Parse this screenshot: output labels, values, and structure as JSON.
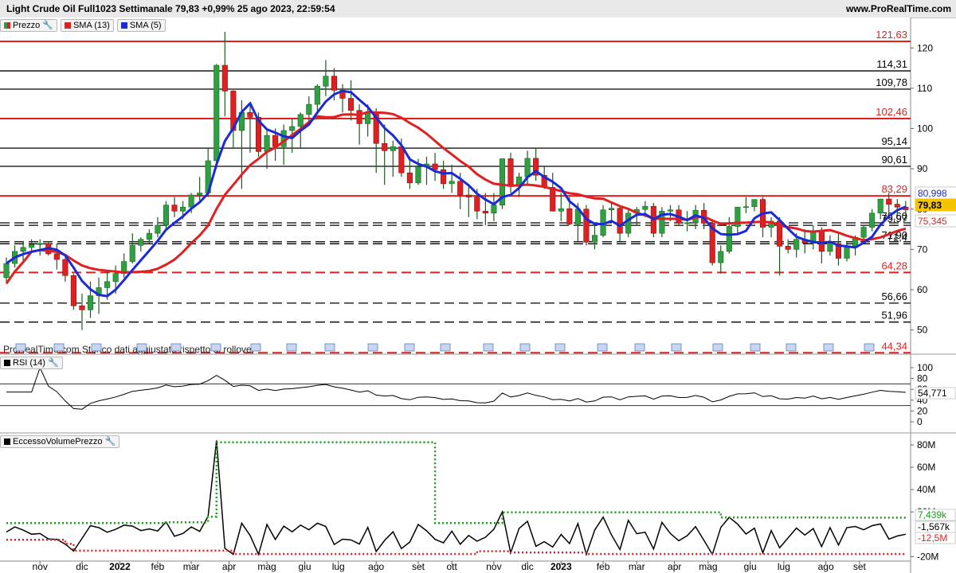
{
  "header": {
    "title": "Light Crude Oil Full1023 Settimanale 79,83 +0,99% 25 ago 2023, 22:59:54",
    "site": "www.ProRealTime.com"
  },
  "legend_main": [
    {
      "name": "legend-prezzo",
      "label": "Prezzo",
      "swatch": "split"
    },
    {
      "name": "legend-sma13",
      "label": "SMA (13)",
      "swatch": "#e02020"
    },
    {
      "name": "legend-sma5",
      "label": "SMA (5)",
      "swatch": "#1a2bd6"
    }
  ],
  "legend_rsi": {
    "label": "RSI (14)"
  },
  "legend_vol": {
    "label": "EccessoVolumePrezzo"
  },
  "watermark": "ProRealTime.com Storico dati aggiustato rispetto ai rollover",
  "colors": {
    "up": "#2ea043",
    "down": "#e02020",
    "sma13": "#e02020",
    "sma5": "#1a2bd6",
    "rsi": "#000000",
    "band_top": "#1b9a1b",
    "band_bottom": "#e02020"
  },
  "chart_data": [
    {
      "type": "candlestick",
      "title": "Light Crude Oil Full1023 Settimanale",
      "ylim": [
        44,
        124
      ],
      "yticks": [
        50,
        60,
        70,
        80,
        90,
        100,
        110,
        120
      ],
      "x_labels": [
        "nov",
        "dic",
        "2022",
        "feb",
        "mar",
        "apr",
        "mag",
        "giu",
        "lug",
        "ago",
        "set",
        "ott",
        "nov",
        "dic",
        "2023",
        "feb",
        "mar",
        "apr",
        "mag",
        "giu",
        "lug",
        "ago",
        "set"
      ],
      "x_label_weeks": [
        4,
        9,
        13.5,
        18,
        22,
        26.5,
        31,
        35.5,
        39.5,
        44,
        49,
        53,
        58,
        62,
        66,
        71,
        75,
        79.5,
        83.5,
        88.5,
        92.5,
        97.5,
        101.5
      ],
      "levels": [
        {
          "value": 121.63,
          "label": "121,63",
          "style": "solid",
          "color": "#e02020"
        },
        {
          "value": 114.31,
          "label": "114,31",
          "style": "solid",
          "color": "#000000"
        },
        {
          "value": 109.78,
          "label": "109,78",
          "style": "solid",
          "color": "#000000"
        },
        {
          "value": 102.46,
          "label": "102,46",
          "style": "solid",
          "color": "#e02020"
        },
        {
          "value": 95.14,
          "label": "95,14",
          "style": "solid",
          "color": "#000000"
        },
        {
          "value": 90.61,
          "label": "90,61",
          "style": "solid",
          "color": "#000000"
        },
        {
          "value": 83.29,
          "label": "83,29",
          "style": "solid",
          "color": "#e02020"
        },
        {
          "value": 76.6,
          "label": "76,60",
          "style": "dashed",
          "color": "#000000"
        },
        {
          "value": 75.97,
          "label": "75,97",
          "style": "dashed",
          "color": "#000000"
        },
        {
          "value": 71.9,
          "label": "71,90",
          "style": "dashed",
          "color": "#000000"
        },
        {
          "value": 71.4,
          "label": "71,4",
          "style": "dashed",
          "color": "#000000"
        },
        {
          "value": 64.28,
          "label": "64,28",
          "style": "dashed",
          "color": "#e02020"
        },
        {
          "value": 56.66,
          "label": "56,66",
          "style": "dashed",
          "color": "#000000"
        },
        {
          "value": 51.96,
          "label": "51,96",
          "style": "dashed",
          "color": "#000000"
        },
        {
          "value": 44.34,
          "label": "44,34",
          "style": "dashed",
          "color": "#e02020"
        }
      ],
      "badges": [
        {
          "label": "80,998",
          "value": 81.0,
          "bg": "#ffffff",
          "fg": "#1a2bd6"
        },
        {
          "label": "79,83",
          "value": 79.83,
          "bg": "#f5c400",
          "fg": "#000000"
        },
        {
          "label": "75,345",
          "value": 75.35,
          "bg": "#ffffff",
          "fg": "#e02020"
        }
      ],
      "candles": [
        [
          63.0,
          68.0,
          62.0,
          66.5
        ],
        [
          66.5,
          71.0,
          65.5,
          69.5
        ],
        [
          69.5,
          72.0,
          67.0,
          70.5
        ],
        [
          70.5,
          72.5,
          69.5,
          71.2
        ],
        [
          71.2,
          72.5,
          68.5,
          71.5
        ],
        [
          71.5,
          72.0,
          68.5,
          68.9
        ],
        [
          68.9,
          71.5,
          65.0,
          67.5
        ],
        [
          67.5,
          68.0,
          62.0,
          63.5
        ],
        [
          63.5,
          64.0,
          55.0,
          56.0
        ],
        [
          56.0,
          59.0,
          50.0,
          55.0
        ],
        [
          55.0,
          62.0,
          53.0,
          58.5
        ],
        [
          58.5,
          63.0,
          54.0,
          60.5
        ],
        [
          60.5,
          64.5,
          57.5,
          62.0
        ],
        [
          62.0,
          66.0,
          59.0,
          64.0
        ],
        [
          64.0,
          69.0,
          63.0,
          67.0
        ],
        [
          67.0,
          74.0,
          66.5,
          71.0
        ],
        [
          71.0,
          73.0,
          69.5,
          72.5
        ],
        [
          72.5,
          75.0,
          71.5,
          74.0
        ],
        [
          74.0,
          78.0,
          73.0,
          76.0
        ],
        [
          76.0,
          82.0,
          75.0,
          81.0
        ],
        [
          81.0,
          83.0,
          78.0,
          79.5
        ],
        [
          79.5,
          82.0,
          77.5,
          80.5
        ],
        [
          80.5,
          84.0,
          79.0,
          83.5
        ],
        [
          83.5,
          88.0,
          82.0,
          84.0
        ],
        [
          84.0,
          95.0,
          83.0,
          92.0
        ],
        [
          92.0,
          116.0,
          90.0,
          115.7
        ],
        [
          115.7,
          124.0,
          103.0,
          109.3
        ],
        [
          109.3,
          109.5,
          95.0,
          99.5
        ],
        [
          99.5,
          107.0,
          85.0,
          104.0
        ],
        [
          104.0,
          106.0,
          94.0,
          102.8
        ],
        [
          102.8,
          104.0,
          93.0,
          94.3
        ],
        [
          94.3,
          99.5,
          90.0,
          98.3
        ],
        [
          98.3,
          100.0,
          92.0,
          95.5
        ],
        [
          95.5,
          101.0,
          91.0,
          99.5
        ],
        [
          99.5,
          102.5,
          94.0,
          100.5
        ],
        [
          100.5,
          104.0,
          95.0,
          103.5
        ],
        [
          103.5,
          108.0,
          101.0,
          106.0
        ],
        [
          106.0,
          111.0,
          104.0,
          110.5
        ],
        [
          110.5,
          117.0,
          108.0,
          113.0
        ],
        [
          113.0,
          115.0,
          107.0,
          109.5
        ],
        [
          109.5,
          111.0,
          104.0,
          107.5
        ],
        [
          107.5,
          112.0,
          102.0,
          104.5
        ],
        [
          104.5,
          106.0,
          96.0,
          101.2
        ],
        [
          101.2,
          106.0,
          98.0,
          104.0
        ],
        [
          104.0,
          105.0,
          89.0,
          96.3
        ],
        [
          96.3,
          101.0,
          86.0,
          94.5
        ],
        [
          94.5,
          97.0,
          88.0,
          95.5
        ],
        [
          95.5,
          97.5,
          88.0,
          89.0
        ],
        [
          89.0,
          93.0,
          85.0,
          86.5
        ],
        [
          86.5,
          92.5,
          86.0,
          90.5
        ],
        [
          90.5,
          93.0,
          86.0,
          91.2
        ],
        [
          91.2,
          94.0,
          87.0,
          89.8
        ],
        [
          89.8,
          92.0,
          85.0,
          86.3
        ],
        [
          86.3,
          91.0,
          84.0,
          86.9
        ],
        [
          86.9,
          89.0,
          80.0,
          83.5
        ],
        [
          83.5,
          86.0,
          78.0,
          83.0
        ],
        [
          83.0,
          85.0,
          77.5,
          79.5
        ],
        [
          79.5,
          84.0,
          76.0,
          79.0
        ],
        [
          79.0,
          84.0,
          77.0,
          81.0
        ],
        [
          81.0,
          92.0,
          80.0,
          92.5
        ],
        [
          92.5,
          94.0,
          84.0,
          85.6
        ],
        [
          85.6,
          89.0,
          83.0,
          88.0
        ],
        [
          88.0,
          94.5,
          86.0,
          92.6
        ],
        [
          92.6,
          95.0,
          87.0,
          88.4
        ],
        [
          88.4,
          90.5,
          85.0,
          85.4
        ],
        [
          85.4,
          89.0,
          80.0,
          79.5
        ],
        [
          79.5,
          84.0,
          77.0,
          80.1
        ],
        [
          80.1,
          83.0,
          76.0,
          76.3
        ],
        [
          76.3,
          81.5,
          72.0,
          80.0
        ],
        [
          80.0,
          81.0,
          71.0,
          71.8
        ],
        [
          71.8,
          76.0,
          70.0,
          73.5
        ],
        [
          73.5,
          81.0,
          73.0,
          79.8
        ],
        [
          79.8,
          81.5,
          76.5,
          80.2
        ],
        [
          80.2,
          81.0,
          72.0,
          74.0
        ],
        [
          74.0,
          80.0,
          73.0,
          79.0
        ],
        [
          79.0,
          80.5,
          76.0,
          79.9
        ],
        [
          79.9,
          82.0,
          78.0,
          80.7
        ],
        [
          80.7,
          81.5,
          73.0,
          74.0
        ],
        [
          74.0,
          80.5,
          73.0,
          79.5
        ],
        [
          79.5,
          81.0,
          77.0,
          79.8
        ],
        [
          79.8,
          81.0,
          76.0,
          76.5
        ],
        [
          76.5,
          79.5,
          74.5,
          76.6
        ],
        [
          76.6,
          81.0,
          75.0,
          79.7
        ],
        [
          79.7,
          81.5,
          75.0,
          76.5
        ],
        [
          76.5,
          77.5,
          66.0,
          66.7
        ],
        [
          66.7,
          71.0,
          64.0,
          69.5
        ],
        [
          69.5,
          78.0,
          69.0,
          75.7
        ],
        [
          75.7,
          80.0,
          74.0,
          80.5
        ],
        [
          80.5,
          83.0,
          79.0,
          80.6
        ],
        [
          80.6,
          82.0,
          79.5,
          82.4
        ],
        [
          82.4,
          83.0,
          73.0,
          75.5
        ],
        [
          75.5,
          78.0,
          73.0,
          77.0
        ],
        [
          77.0,
          78.0,
          63.5,
          70.8
        ],
        [
          70.8,
          72.5,
          69.0,
          70.0
        ],
        [
          70.0,
          74.0,
          68.0,
          72.5
        ],
        [
          72.5,
          75.0,
          69.0,
          71.5
        ]
      ],
      "candles_tail": [
        [
          71.5,
          76.0,
          70.0,
          74.5
        ],
        [
          74.5,
          75.5,
          66.5,
          69.5
        ],
        [
          69.5,
          73.5,
          68.5,
          71.5
        ],
        [
          71.5,
          74.0,
          66.0,
          67.8
        ],
        [
          67.8,
          72.0,
          67.0,
          70.5
        ],
        [
          70.5,
          73.5,
          68.5,
          73.0
        ],
        [
          73.0,
          76.0,
          72.0,
          75.5
        ],
        [
          75.5,
          80.0,
          74.5,
          79.0
        ],
        [
          79.0,
          81.5,
          77.5,
          82.5
        ],
        [
          82.5,
          84.0,
          79.0,
          81.2
        ],
        [
          81.2,
          82.5,
          78.5,
          80.5
        ],
        [
          80.5,
          82.0,
          77.0,
          79.83
        ]
      ],
      "sma5": [
        58,
        60,
        62,
        63.5,
        65,
        66.5,
        68,
        68.5,
        68.8,
        68.5,
        67.8,
        66,
        64,
        61.5,
        59,
        57,
        56,
        55.5,
        55.5,
        56.5,
        58,
        59.5,
        61,
        62.5,
        64.5,
        67,
        69.5,
        72,
        74,
        76,
        78,
        80,
        82,
        83.5,
        85,
        86.5,
        88.5,
        91,
        95,
        96.5,
        97.5,
        98.5,
        99,
        98.5,
        97.5,
        96.7,
        97,
        98,
        99.5,
        101,
        103,
        105,
        107.5,
        109,
        109.2,
        108.8,
        108,
        107,
        105.5,
        104,
        102,
        99.5,
        98,
        97.5,
        97,
        95,
        93,
        91,
        89.7,
        88.5,
        88,
        87.5,
        87.2,
        87.5,
        87.5,
        87.3,
        86.5,
        86,
        85.5,
        84.5,
        83.5,
        83,
        82.3,
        82.3,
        83,
        84,
        85,
        86.5,
        88.5,
        89.5,
        89,
        87.5,
        85.5,
        84,
        82.7,
        80.8,
        79,
        77.5,
        77,
        76.8,
        77.5,
        78.5,
        79,
        78.3,
        77.8,
        77.5,
        77.7,
        77.8,
        78.3,
        78.5,
        79.5,
        79.7,
        78.7,
        78,
        76.5,
        76.3,
        75,
        74.6,
        72.5,
        72,
        72.3,
        73.1,
        74.4,
        75.8,
        76.6,
        77.0,
        76.5,
        75.6,
        74.5,
        73.5,
        72.8,
        72.2,
        71.9,
        71.5,
        71.5,
        70.8,
        70.2,
        70.0,
        70.5,
        71.3,
        72.5,
        73.6,
        75.0,
        76.9,
        78.3,
        79.5,
        80.4,
        81.0
      ]
    }
  ],
  "rsi": {
    "label": "RSI (14)",
    "ylim": [
      20,
      100
    ],
    "yticks": [
      100,
      80,
      60,
      40,
      20,
      0
    ],
    "ref_levels": [
      70,
      30
    ],
    "current_label": "54,771"
  },
  "eccesso": {
    "label": "EccessoVolumePrezzo",
    "ylim": [
      -24,
      90
    ],
    "yticks": [
      {
        "v": 80,
        "label": "80M"
      },
      {
        "v": 60,
        "label": "60M"
      },
      {
        "v": 40,
        "label": "40M"
      },
      {
        "v": 20,
        "label": "20M"
      },
      {
        "v": -20,
        "label": "-20M"
      }
    ],
    "badges": [
      {
        "label": "7,439k",
        "fg": "#1b9a1b"
      },
      {
        "label": "-1,567k",
        "fg": "#000000"
      },
      {
        "label": "-12,5M",
        "fg": "#e02020"
      }
    ]
  }
}
